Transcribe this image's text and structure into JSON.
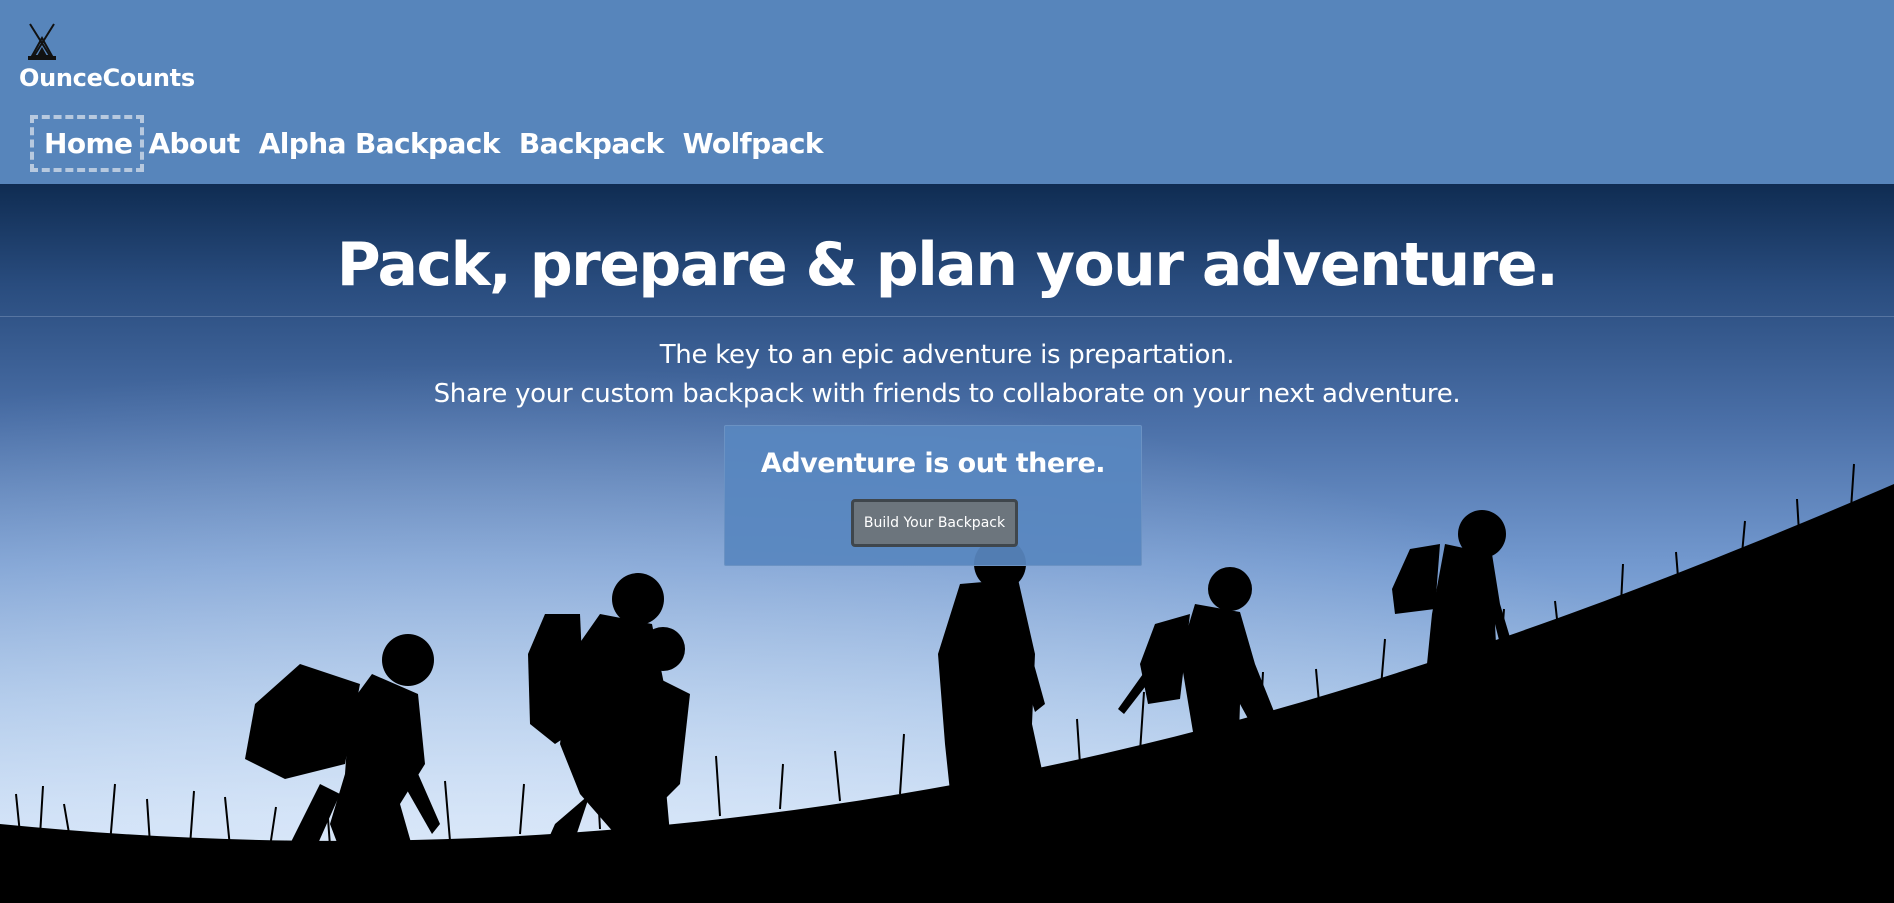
{
  "header": {
    "brand_name": "OunceCounts",
    "logo_icon": "tent-camp-icon",
    "background_color": "#5785bb"
  },
  "nav": {
    "items": [
      {
        "label": "Home",
        "active": true
      },
      {
        "label": "About",
        "active": false
      },
      {
        "label": "Alpha Backpack",
        "active": false
      },
      {
        "label": "Backpack",
        "active": false
      },
      {
        "label": "Wolfpack",
        "active": false
      }
    ]
  },
  "hero": {
    "title": "Pack, prepare & plan your adventure.",
    "subtitle_line1": "The key to an epic adventure is prepartation.",
    "subtitle_line2": "Share your custom backpack with friends to collaborate on your next adventure.",
    "background_image": "hikers-silhouette-hillside-dusk"
  },
  "cta": {
    "heading": "Adventure is out there.",
    "button_label": "Build Your Backpack",
    "button_color": "#6c757d"
  }
}
